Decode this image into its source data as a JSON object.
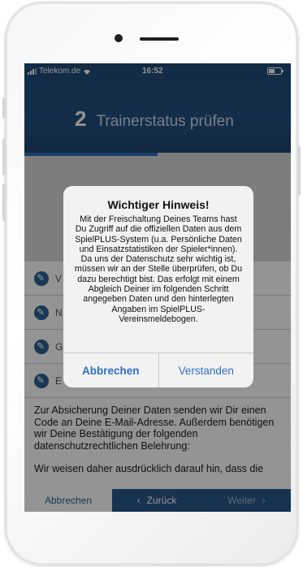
{
  "status_bar": {
    "carrier": "Telekom.de",
    "time": "16:52"
  },
  "header": {
    "step_number": "2",
    "step_title": "Trainerstatus prüfen",
    "progress": 0.5
  },
  "list_rows": [
    "V",
    "N",
    "G",
    "E"
  ],
  "info": {
    "paragraph1": "Zur Absicherung Deiner Daten senden wir Dir einen Code an Deine E-Mail-Adresse. Außerdem benötigen wir Deine Bestätigung der folgenden datenschutzrechtlichen Belehrung:",
    "paragraph2": "Wir weisen daher ausdrücklich darauf hin, dass die"
  },
  "bottom_bar": {
    "cancel": "Abbrechen",
    "back": "Zurück",
    "next": "Weiter"
  },
  "dialog": {
    "title": "Wichtiger Hinweis!",
    "message": "Mit der Freischaltung Deines Teams hast Du Zugriff auf die offiziellen Daten aus dem SpielPLUS-System (u.a. Persönliche Daten und Einsatzstatistiken der Spieler*innen). Da uns der Datenschutz sehr wichtig ist, müssen wir an der Stelle überprüfen, ob Du dazu berechtigt bist. Das erfolgt mit einem Abgleich Deiner im folgenden Schritt angegeben Daten und den hinterlegten Angaben im SpielPLUS-Vereinsmeldebogen.",
    "cancel_label": "Abbrechen",
    "confirm_label": "Verstanden"
  },
  "colors": {
    "header": "#1f4a78",
    "accent": "#2f6fc4",
    "bar": "#2a5989"
  },
  "icons": {
    "signal": "signal-icon",
    "wifi": "wifi-icon",
    "battery": "battery-icon",
    "edit": "pencil-icon",
    "back": "chevron-left-icon",
    "next": "chevron-right-icon"
  }
}
